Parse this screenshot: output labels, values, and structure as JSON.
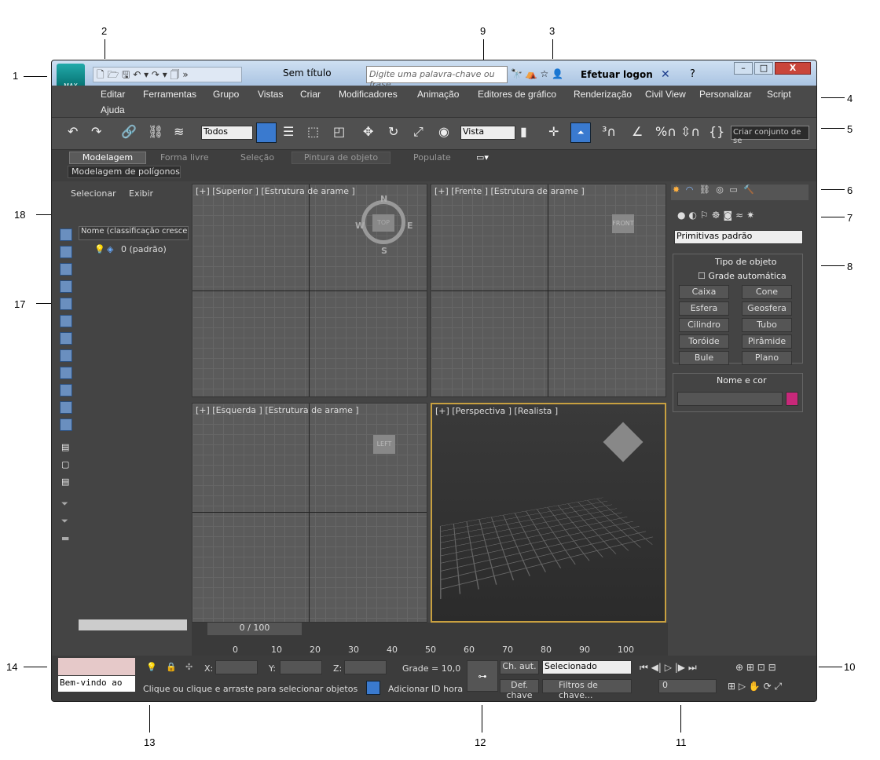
{
  "callouts": {
    "n1": "1",
    "n2": "2",
    "n3": "3",
    "n4": "4",
    "n5": "5",
    "n6": "6",
    "n7": "7",
    "n8": "8",
    "n9": "9",
    "n10": "10",
    "n11": "11",
    "n12": "12",
    "n13": "13",
    "n14": "14",
    "n17": "17",
    "n18": "18"
  },
  "title": {
    "app": "Sem título",
    "search_placeholder": "Digite uma palavra-chave ou frase",
    "login": "Efetuar logon",
    "logo_text": "MAX"
  },
  "menu": [
    "Editar",
    "Ferramentas",
    "Grupo",
    "Vistas",
    "Criar",
    "Modificadores",
    "Animação",
    "Editores de gráfico",
    "Renderização",
    "Civil View",
    "Personalizar",
    "Script",
    "Ajuda"
  ],
  "toolbar": {
    "select_filter": "Todos",
    "ref_coord": "Vista",
    "selection_set_placeholder": "Criar conjunto de se"
  },
  "ribbon": {
    "tabs": [
      "Modelagem",
      "Forma livre",
      "Seleção",
      "Pintura de objeto",
      "Populate"
    ],
    "subtab": "Modelagem de polígonos"
  },
  "scene_explorer": {
    "menu1": "Selecionar",
    "menu2": "Exibir",
    "column": "Nome (classificação crescent",
    "layer": "0 (padrão)"
  },
  "viewports": {
    "top": "[+] [Superior ] [Estrutura de arame ]",
    "front": "[+] [Frente ] [Estrutura de arame ]",
    "left": "[+] [Esquerda ] [Estrutura de arame ]",
    "persp": "[+] [Perspectiva ] [Realista ]"
  },
  "compass": {
    "n": "N",
    "s": "S",
    "e": "E",
    "w": "W",
    "top": "TOP",
    "front": "FRONT",
    "left": "LEFT"
  },
  "command_panel": {
    "dropdown": "Primitivas padrão",
    "rollout1": "Tipo de objeto",
    "autogrid": "Grade automática",
    "buttons": [
      "Caixa",
      "Cone",
      "Esfera",
      "Geosfera",
      "Cilindro",
      "Tubo",
      "Toróide",
      "Pirâmide",
      "Bule",
      "Plano"
    ],
    "rollout2": "Nome e cor",
    "color": "#c8287a"
  },
  "timeline": {
    "counter": "0 / 100",
    "ticks": [
      "0",
      "10",
      "20",
      "30",
      "40",
      "50",
      "60",
      "70",
      "80",
      "90",
      "100"
    ]
  },
  "status": {
    "welcome": "Bem-vindo ao",
    "prompt": "Clique ou clique e arraste para selecionar objetos",
    "x": "X:",
    "y": "Y:",
    "z": "Z:",
    "grid": "Grade = 10,0",
    "add_time_tag": "Adicionar ID hora",
    "auto_key": "Ch. aut.",
    "set_key": "Def. chave",
    "selected": "Selecionado",
    "key_filters": "Filtros de chave...",
    "frame": "0"
  }
}
